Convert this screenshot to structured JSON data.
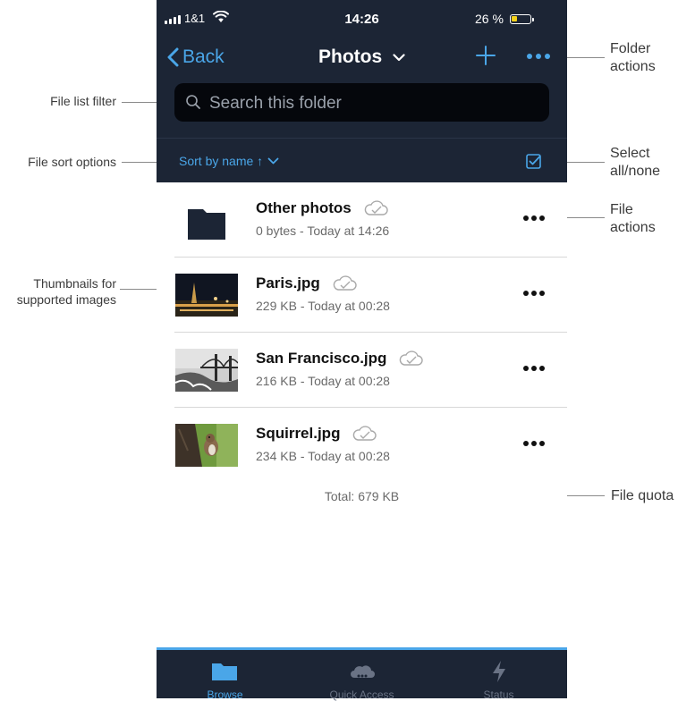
{
  "annotations": {
    "file_list_filter": "File list filter",
    "file_sort_options": "File sort options",
    "thumbnails_line1": "Thumbnails for",
    "thumbnails_line2": "supported images",
    "folder_actions_line1": "Folder",
    "folder_actions_line2": "actions",
    "select_line1": "Select",
    "select_line2": "all/none",
    "file_actions_line1": "File",
    "file_actions_line2": "actions",
    "file_quota": "File quota"
  },
  "status_bar": {
    "carrier": "1&1",
    "time": "14:26",
    "battery": "26 %"
  },
  "nav": {
    "back_label": "Back",
    "title": "Photos"
  },
  "search": {
    "placeholder": "Search this folder"
  },
  "sort": {
    "label": "Sort by name ↑"
  },
  "files": [
    {
      "name": "Other photos",
      "meta": "0 bytes - Today at 14:26",
      "type": "folder"
    },
    {
      "name": "Paris.jpg",
      "meta": "229 KB - Today at 00:28",
      "type": "image"
    },
    {
      "name": "San Francisco.jpg",
      "meta": "216 KB - Today at 00:28",
      "type": "image"
    },
    {
      "name": "Squirrel.jpg",
      "meta": "234 KB - Today at 00:28",
      "type": "image"
    }
  ],
  "total": "Total: 679 KB",
  "tabs": [
    {
      "label": "Browse",
      "icon": "folder-icon",
      "active": true
    },
    {
      "label": "Quick Access",
      "icon": "cloud-icon",
      "active": false
    },
    {
      "label": "Status",
      "icon": "bolt-icon",
      "active": false
    }
  ],
  "colors": {
    "header_bg": "#1c2535",
    "accent": "#4aa6e8",
    "battery_fill": "#f3d11a"
  }
}
